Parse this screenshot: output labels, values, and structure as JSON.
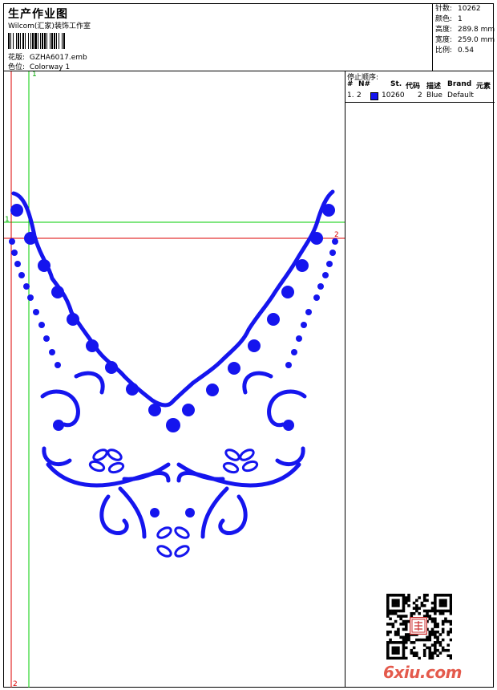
{
  "header": {
    "title": "生产作业图",
    "company": "Wilcom(汇家)装饰工作室",
    "design_label": "花版:",
    "design_value": "GZHA6017.emb",
    "colorway_label": "色位:",
    "colorway_value": "Colorway 1"
  },
  "stats": [
    {
      "label": "针数:",
      "value": "10262"
    },
    {
      "label": "颜色:",
      "value": "1"
    },
    {
      "label": "高度:",
      "value": "289.8 mm"
    },
    {
      "label": "宽度:",
      "value": "259.0 mm"
    },
    {
      "label": "比例:",
      "value": "0.54"
    }
  ],
  "stop_sequence": {
    "title": "停止顺序:",
    "columns": [
      "#",
      "N#",
      "St.",
      "代码",
      "描述",
      "Brand",
      "元素"
    ],
    "rows": [
      {
        "num": "1.",
        "needle": "2",
        "stitches": "10260",
        "code": "2",
        "desc": "Blue",
        "brand": "Default",
        "color": "#1515ee"
      }
    ]
  },
  "guides": {
    "v_green": "1",
    "h_green": "1",
    "h_red": "2",
    "v_red": "2"
  },
  "watermark": {
    "text": "6xiu.com"
  },
  "colors": {
    "thread": "#1515ee",
    "guide_green": "#00cc00",
    "guide_red": "#dd0000",
    "watermark": "#e45a4c"
  }
}
